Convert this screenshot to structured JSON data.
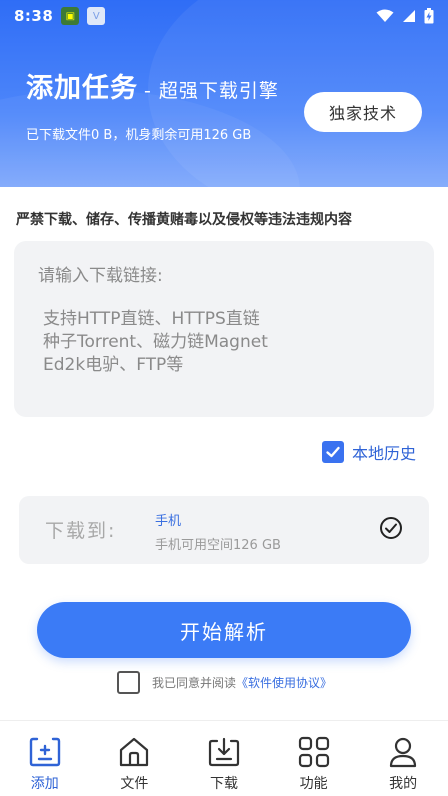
{
  "status_bar": {
    "time": "8:38"
  },
  "header": {
    "title": "添加任务",
    "subtitle": "- 超强下载引擎",
    "stats": "已下载文件0 B，机身剩余可用126 GB",
    "tech_button": "独家技术"
  },
  "warning": "严禁下载、储存、传播黄赌毒以及侵权等违法违规内容",
  "link_input": {
    "placeholder_title": "请输入下载链接:",
    "placeholder_lines": [
      "支持HTTP直链、HTTPS直链",
      "种子Torrent、磁力链Magnet",
      "Ed2k电驴、FTP等"
    ]
  },
  "history": {
    "label": "本地历史",
    "checked": true
  },
  "destination": {
    "label": "下载到:",
    "device": "手机",
    "space": "手机可用空间126 GB"
  },
  "start_button": "开始解析",
  "agreement": {
    "prefix": "我已同意并阅读",
    "link": "《软件使用协议》",
    "checked": false
  },
  "nav": {
    "items": [
      {
        "label": "添加",
        "icon": "add-square-icon",
        "active": true
      },
      {
        "label": "文件",
        "icon": "home-icon",
        "active": false
      },
      {
        "label": "下载",
        "icon": "download-tray-icon",
        "active": false
      },
      {
        "label": "功能",
        "icon": "grid-icon",
        "active": false
      },
      {
        "label": "我的",
        "icon": "user-icon",
        "active": false
      }
    ]
  },
  "colors": {
    "accent": "#3b7bf6",
    "link": "#3a6fe0",
    "header_top": "#2f6df6"
  }
}
